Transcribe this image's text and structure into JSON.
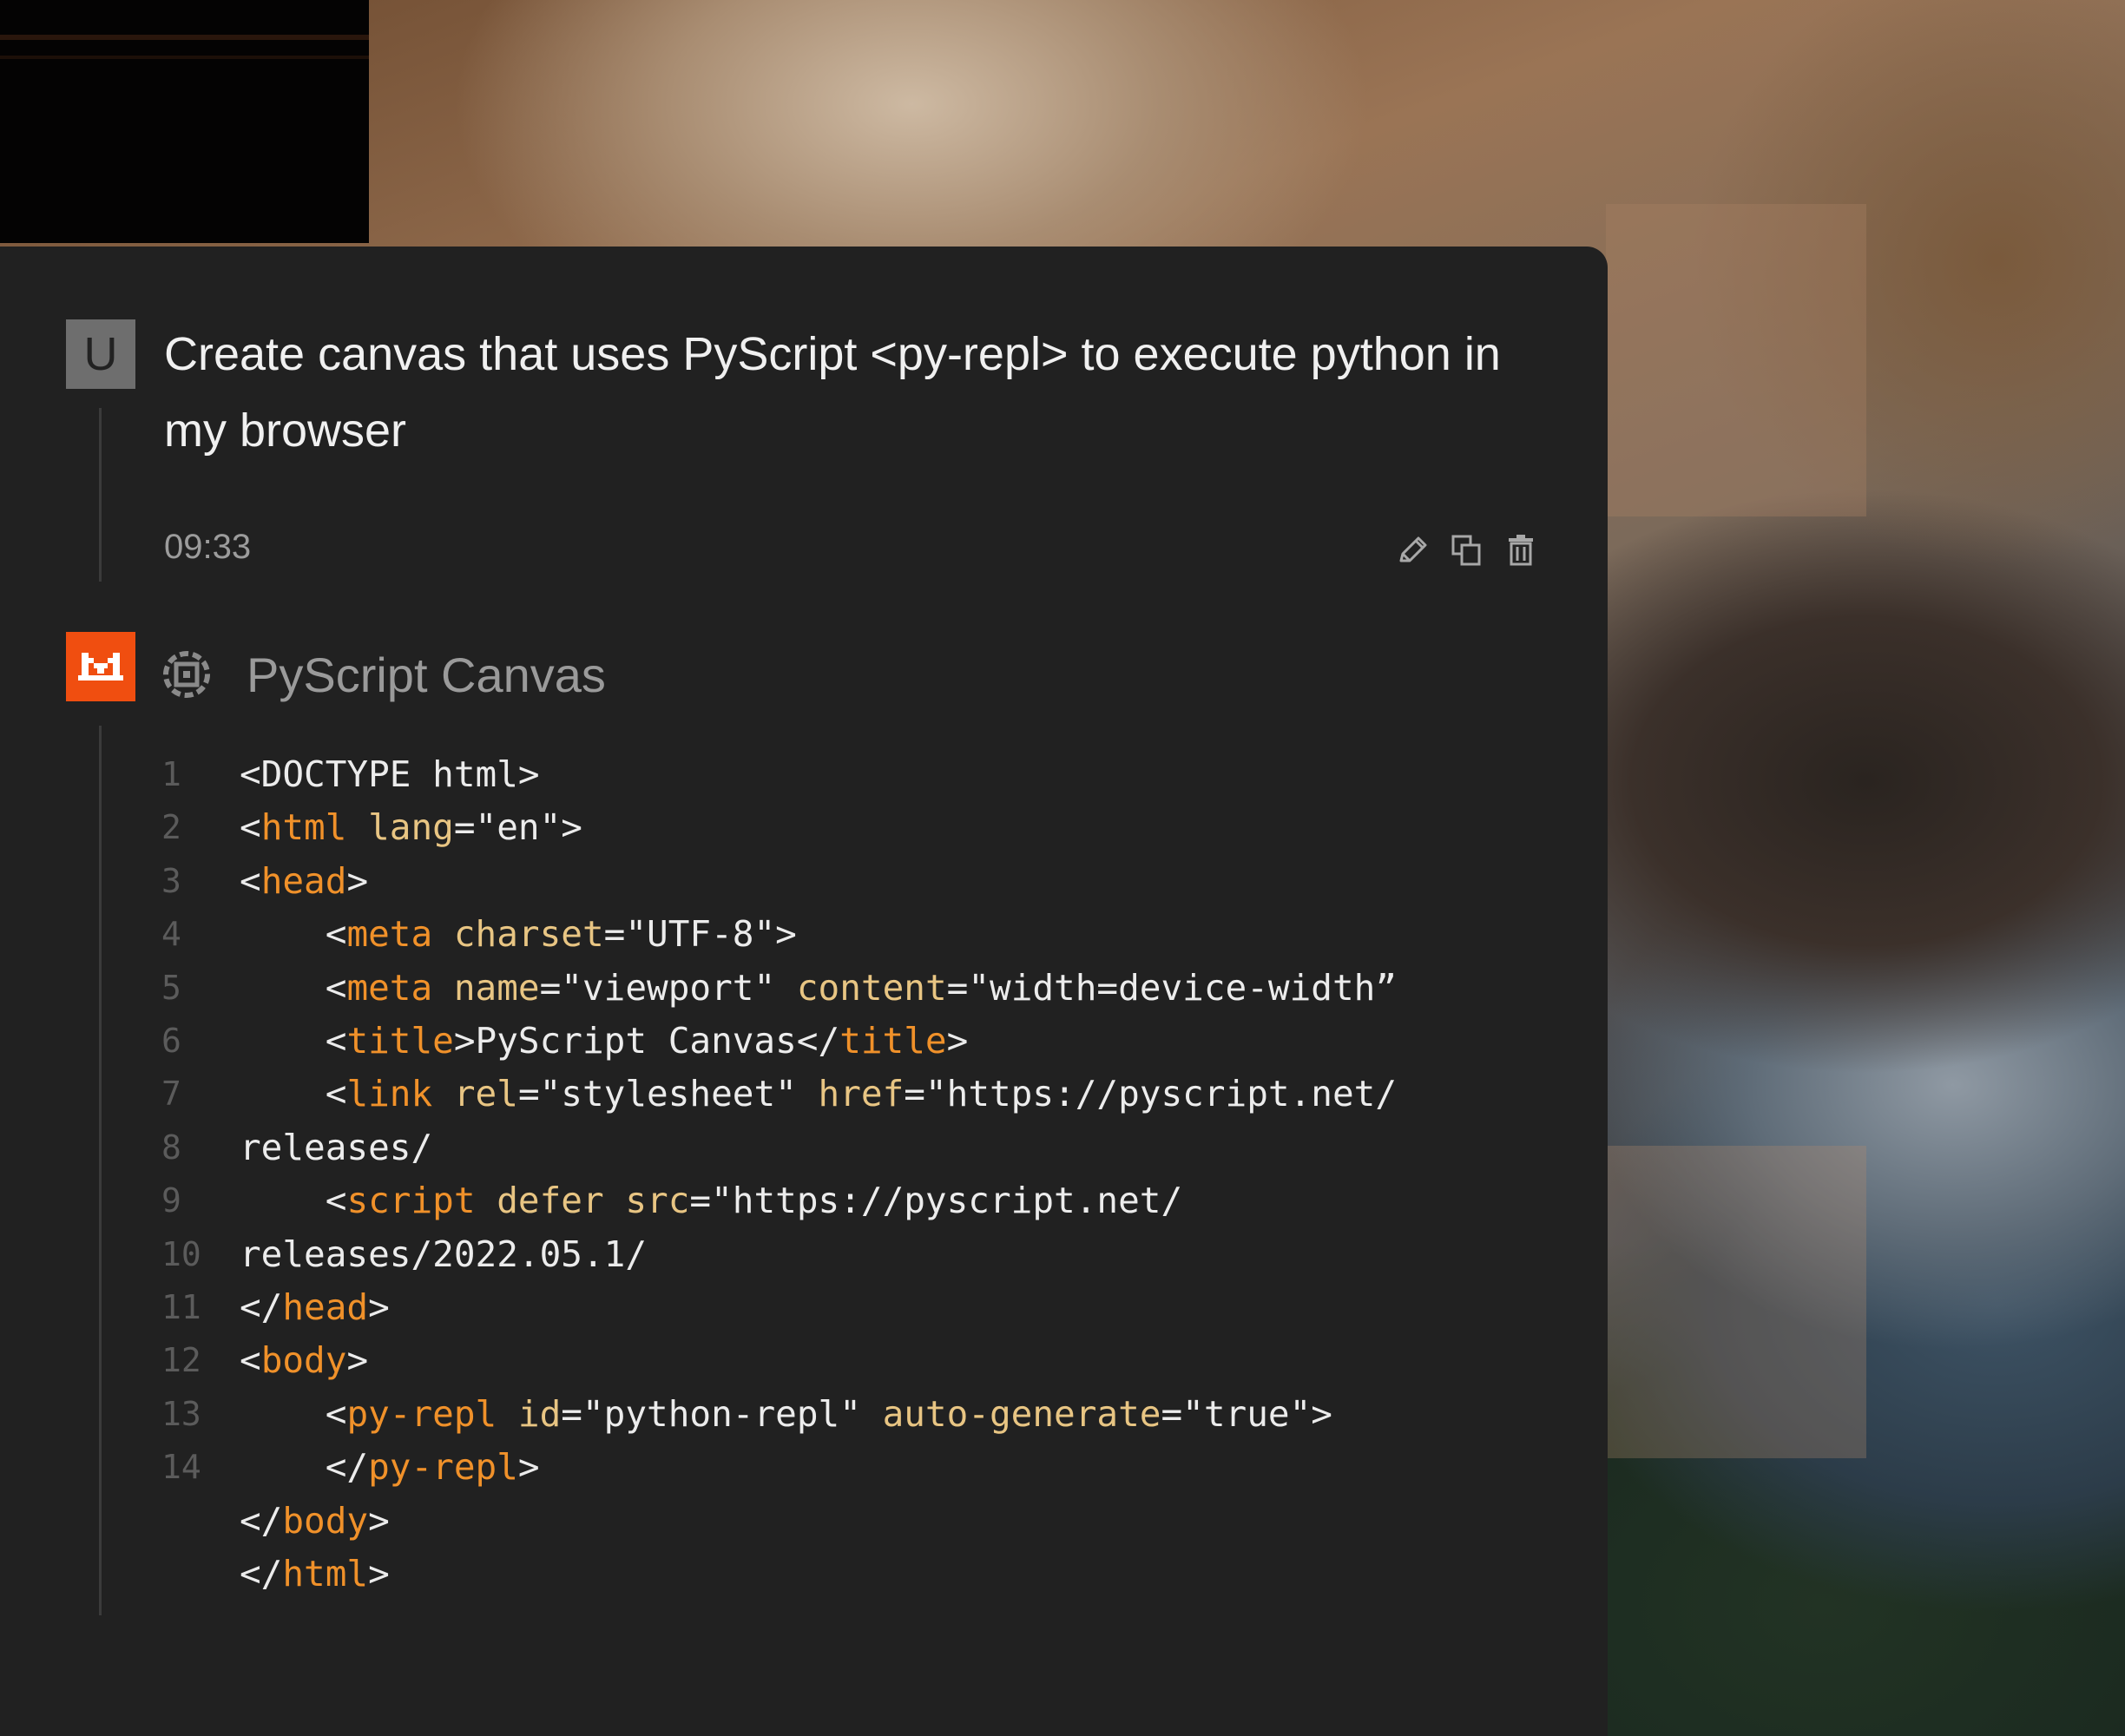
{
  "user_message": {
    "avatar_letter": "U",
    "text": "Create canvas that uses PyScript <py-repl> to execute python in my browser",
    "timestamp": "09:33",
    "actions": [
      "edit-icon",
      "copy-icon",
      "delete-icon"
    ]
  },
  "assistant": {
    "canvas_title": "PyScript Canvas",
    "accent_color": "#f04e10",
    "code_lines": [
      {
        "n": "1",
        "indent": "",
        "parts": [
          [
            "p",
            "<DOCTYPE html>"
          ]
        ]
      },
      {
        "n": "2",
        "indent": "",
        "parts": [
          [
            "p",
            "<"
          ],
          [
            "t",
            "html"
          ],
          [
            "p",
            " "
          ],
          [
            "a",
            "lang"
          ],
          [
            "p",
            "=\"en\">"
          ]
        ]
      },
      {
        "n": "3",
        "indent": "",
        "parts": [
          [
            "p",
            "<"
          ],
          [
            "t",
            "head"
          ],
          [
            "p",
            ">"
          ]
        ]
      },
      {
        "n": "4",
        "indent": "    ",
        "parts": [
          [
            "p",
            "<"
          ],
          [
            "t",
            "meta"
          ],
          [
            "p",
            " "
          ],
          [
            "a",
            "charset"
          ],
          [
            "p",
            "=\"UTF-8\">"
          ]
        ]
      },
      {
        "n": "5",
        "indent": "    ",
        "parts": [
          [
            "p",
            "<"
          ],
          [
            "t",
            "meta"
          ],
          [
            "p",
            " "
          ],
          [
            "a",
            "name"
          ],
          [
            "p",
            "=\"viewport\" "
          ],
          [
            "a",
            "content"
          ],
          [
            "p",
            "=\"width=device-width”"
          ]
        ]
      },
      {
        "n": "6",
        "indent": "    ",
        "parts": [
          [
            "p",
            "<"
          ],
          [
            "t",
            "title"
          ],
          [
            "p",
            ">PyScript Canvas</"
          ],
          [
            "t",
            "title"
          ],
          [
            "p",
            ">"
          ]
        ]
      },
      {
        "n": "7",
        "indent": "    ",
        "parts": [
          [
            "p",
            "<"
          ],
          [
            "t",
            "link"
          ],
          [
            "p",
            " "
          ],
          [
            "a",
            "rel"
          ],
          [
            "p",
            "=\"stylesheet\" "
          ],
          [
            "a",
            "href"
          ],
          [
            "p",
            "=\"https://pyscript.net/"
          ]
        ]
      },
      {
        "n": "8",
        "indent": "",
        "parts": [
          [
            "p",
            "releases/"
          ]
        ]
      },
      {
        "n": "9",
        "indent": "    ",
        "parts": [
          [
            "p",
            "<"
          ],
          [
            "t",
            "script"
          ],
          [
            "p",
            " "
          ],
          [
            "a",
            "defer"
          ],
          [
            "p",
            " "
          ],
          [
            "a",
            "src"
          ],
          [
            "p",
            "=\"https://pyscript.net/"
          ]
        ]
      },
      {
        "n": "10",
        "indent": "",
        "parts": [
          [
            "p",
            "releases/2022.05.1/"
          ]
        ]
      },
      {
        "n": "11",
        "indent": "",
        "parts": [
          [
            "p",
            "</"
          ],
          [
            "t",
            "head"
          ],
          [
            "p",
            ">"
          ]
        ]
      },
      {
        "n": "12",
        "indent": "",
        "parts": [
          [
            "p",
            "<"
          ],
          [
            "t",
            "body"
          ],
          [
            "p",
            ">"
          ]
        ]
      },
      {
        "n": "13",
        "indent": "    ",
        "parts": [
          [
            "p",
            "<"
          ],
          [
            "t",
            "py-repl"
          ],
          [
            "p",
            " "
          ],
          [
            "a",
            "id"
          ],
          [
            "p",
            "=\"python-repl\" "
          ],
          [
            "a",
            "auto-generate"
          ],
          [
            "p",
            "=\"true\">"
          ]
        ]
      },
      {
        "n": "14",
        "indent": "    ",
        "parts": [
          [
            "p",
            "</"
          ],
          [
            "t",
            "py-repl"
          ],
          [
            "p",
            ">"
          ]
        ]
      },
      {
        "n": "",
        "indent": "",
        "parts": [
          [
            "p",
            "</"
          ],
          [
            "t",
            "body"
          ],
          [
            "p",
            ">"
          ]
        ]
      },
      {
        "n": "",
        "indent": "",
        "parts": [
          [
            "p",
            "</"
          ],
          [
            "t",
            "html"
          ],
          [
            "p",
            ">"
          ]
        ]
      }
    ]
  }
}
